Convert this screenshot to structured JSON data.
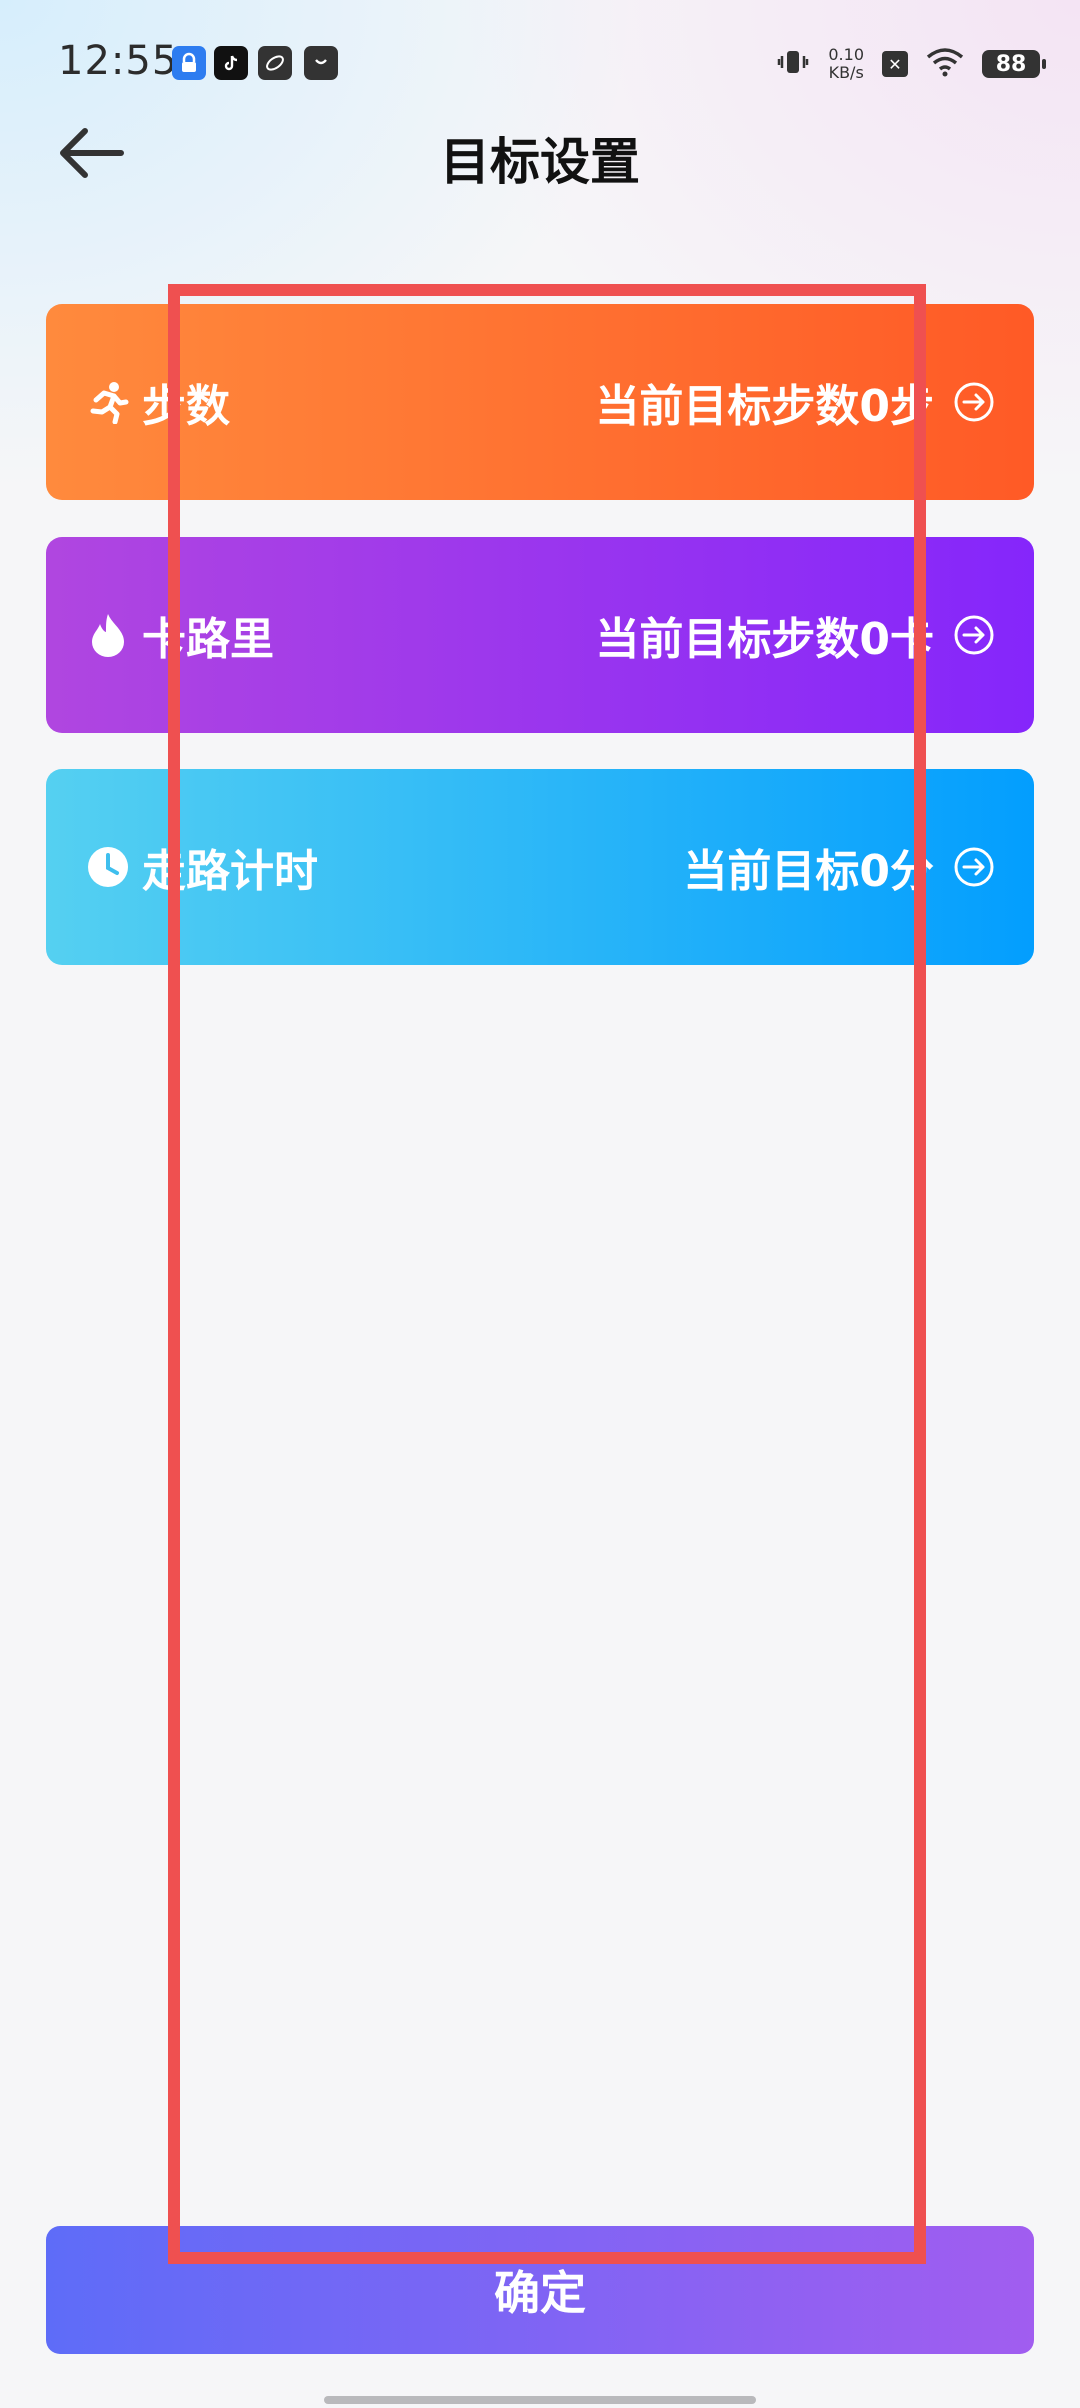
{
  "status_bar": {
    "time": "12:55",
    "network_speed_value": "0.10",
    "network_speed_unit": "KB/s",
    "battery": "88",
    "icons": [
      "vpn-icon",
      "tiktok-icon",
      "leaf-app-icon",
      "shop-app-icon",
      "vibrate-icon",
      "no-sim-icon",
      "wifi-icon"
    ]
  },
  "header": {
    "title": "目标设置",
    "back_icon": "arrow-left-icon"
  },
  "goals": [
    {
      "label": "步数",
      "value": "当前目标步数0步",
      "icon": "running-icon",
      "arrow_icon": "circle-arrow-right-icon",
      "color_start": "#ff8a3d",
      "color_end": "#ff5a26"
    },
    {
      "label": "卡路里",
      "value": "当前目标步数0卡",
      "icon": "flame-icon",
      "arrow_icon": "circle-arrow-right-icon",
      "color_start": "#b046e0",
      "color_end": "#8526fb"
    },
    {
      "label": "走路计时",
      "value": "当前目标0分",
      "icon": "clock-icon",
      "arrow_icon": "circle-arrow-right-icon",
      "color_start": "#55d0f1",
      "color_end": "#039efe"
    }
  ],
  "confirm_button": {
    "label": "确定",
    "color_start": "#5e6cf8",
    "color_end": "#a15df0"
  },
  "annotation": {
    "color": "#ef5050"
  }
}
